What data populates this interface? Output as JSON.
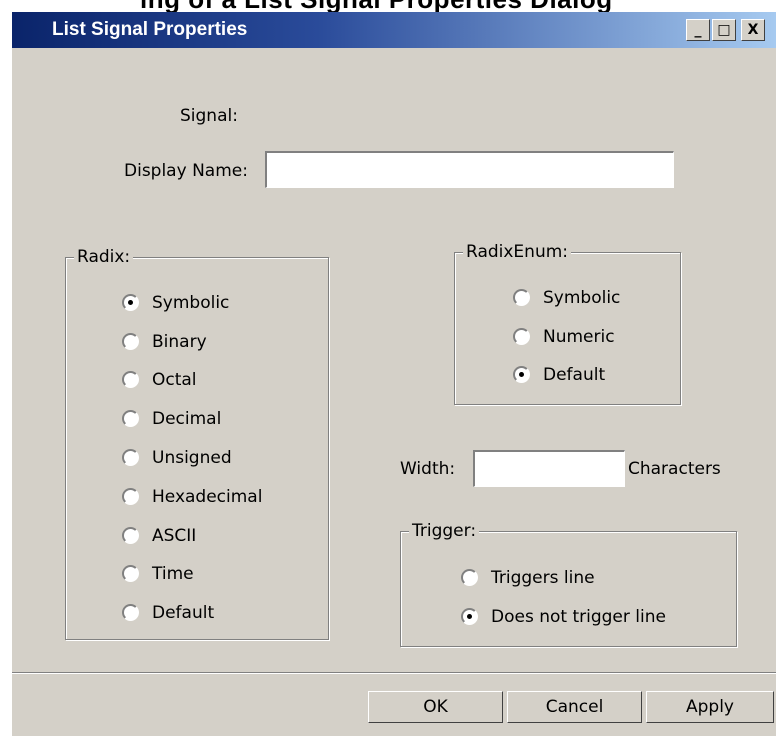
{
  "window": {
    "title": "List Signal Properties",
    "controls": {
      "minimize": "_",
      "maximize": "□",
      "close": "X"
    }
  },
  "background_caption": "ing of a List Signal Properties Dialog",
  "signal": {
    "label": "Signal:",
    "value": ""
  },
  "display_name": {
    "label": "Display Name:",
    "value": ""
  },
  "radix": {
    "legend": "Radix:",
    "selected": "Symbolic",
    "options": [
      "Symbolic",
      "Binary",
      "Octal",
      "Decimal",
      "Unsigned",
      "Hexadecimal",
      "ASCII",
      "Time",
      "Default"
    ]
  },
  "radix_enum": {
    "legend": "RadixEnum:",
    "selected": "Default",
    "options": [
      "Symbolic",
      "Numeric",
      "Default"
    ]
  },
  "width": {
    "label": "Width:",
    "value": "",
    "suffix": "Characters"
  },
  "trigger": {
    "legend": "Trigger:",
    "selected": "Does not trigger line",
    "options": [
      "Triggers line",
      "Does not trigger line"
    ]
  },
  "buttons": {
    "ok": "OK",
    "cancel": "Cancel",
    "apply": "Apply"
  },
  "colors": {
    "titlebar_start": "#0a246a",
    "titlebar_end": "#a6caf0",
    "face": "#d4d0c8"
  }
}
